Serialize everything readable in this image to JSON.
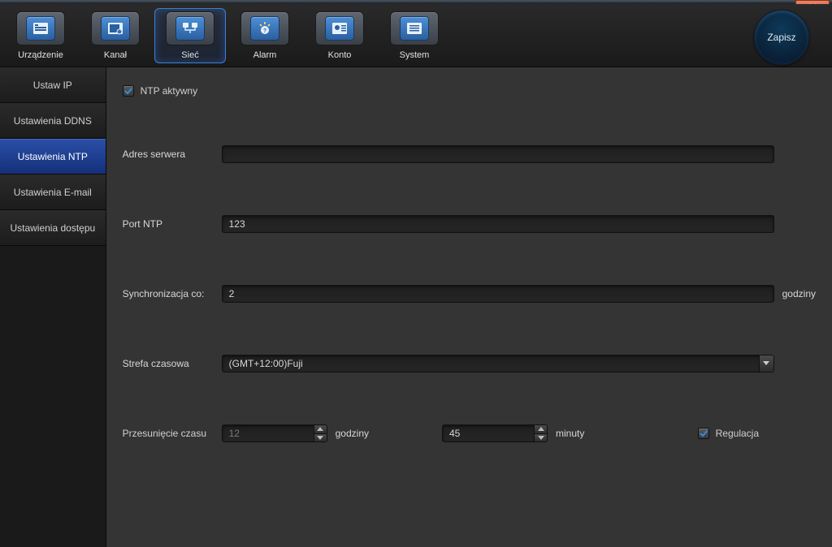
{
  "titlebar": {
    "close": "×"
  },
  "toolbar": {
    "items": [
      {
        "label": "Urządzenie",
        "active": false
      },
      {
        "label": "Kanał",
        "active": false
      },
      {
        "label": "Sieć",
        "active": true
      },
      {
        "label": "Alarm",
        "active": false
      },
      {
        "label": "Konto",
        "active": false
      },
      {
        "label": "System",
        "active": false
      }
    ],
    "save_label": "Zapisz"
  },
  "sidebar": {
    "items": [
      {
        "label": "Ustaw IP",
        "active": false
      },
      {
        "label": "Ustawienia DDNS",
        "active": false
      },
      {
        "label": "Ustawienia NTP",
        "active": true
      },
      {
        "label": "Ustawienia E-mail",
        "active": false
      },
      {
        "label": "Ustawienia dostępu",
        "active": false
      }
    ]
  },
  "form": {
    "ntp_active_label": "NTP aktywny",
    "ntp_active_checked": true,
    "server_label": "Adres serwera",
    "server_value": "",
    "port_label": "Port NTP",
    "port_value": "123",
    "sync_label": "Synchronizacja co:",
    "sync_value": "2",
    "sync_unit": "godziny",
    "tz_label": "Strefa czasowa",
    "tz_value": "(GMT+12:00)Fuji",
    "offset_label": "Przesunięcie czasu",
    "offset_hours_value": "12",
    "offset_hours_unit": "godziny",
    "offset_minutes_value": "45",
    "offset_minutes_unit": "minuty",
    "regulation_label": "Regulacja",
    "regulation_checked": true
  }
}
